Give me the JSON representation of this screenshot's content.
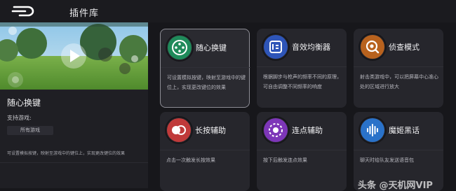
{
  "header": {
    "title": "插件库",
    "logo_icon": "back-logo-icon"
  },
  "selected_plugin": {
    "name": "随心换键",
    "support_label": "支持游戏:",
    "support_chip": "所有游戏",
    "description": "可设置模拟按键，映射至游戏中的键位上，实现更改键位的效果",
    "preview_icon": "game-scene-preview"
  },
  "plugins": [
    {
      "title": "随心换键",
      "desc": "可设置模拟按键，映射至游戏中的键位上，实现更改键位的效果",
      "icon": "remap-keys-icon",
      "color": "#1f8a5a",
      "selected": true
    },
    {
      "title": "音效均衡器",
      "desc": "根据脚步与枪声的频率不同的原理，可自由调整不同频率的响度",
      "icon": "equalizer-icon",
      "color": "#2e55b8",
      "selected": false
    },
    {
      "title": "侦查模式",
      "desc": "射击类游戏中，可以把屏幕中心准心处的区域进行放大",
      "icon": "magnifier-icon",
      "color": "#b8621e",
      "selected": false
    },
    {
      "title": "长按辅助",
      "desc": "点击一次触发长按效果",
      "icon": "long-press-icon",
      "color": "#c03a3a",
      "selected": false
    },
    {
      "title": "连点辅助",
      "desc": "按下后触发连点效果",
      "icon": "auto-tap-icon",
      "color": "#7d36b8",
      "selected": false
    },
    {
      "title": "魔姬黑话",
      "desc": "聊天时给队友发送语音包",
      "icon": "voice-wave-icon",
      "color": "#2a72c9",
      "selected": false
    }
  ],
  "watermark": "头条 @天机网VIP"
}
